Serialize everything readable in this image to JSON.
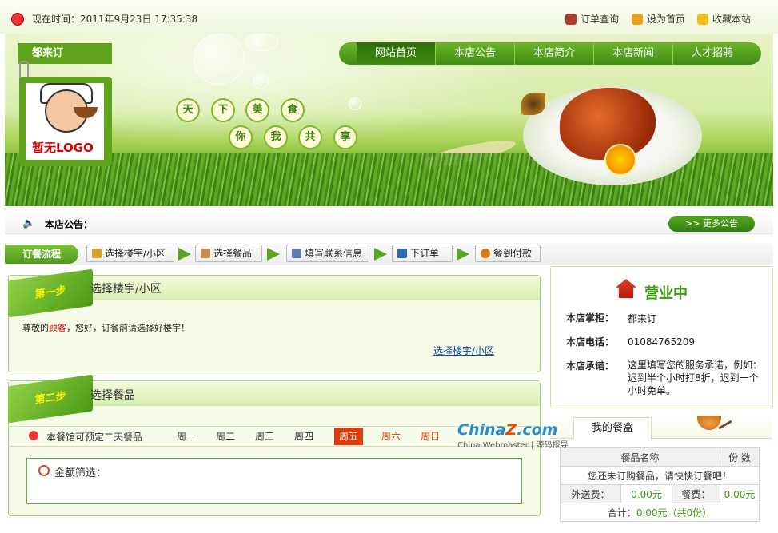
{
  "topbar": {
    "time_label": "现在时间：2011年9月23日 17:35:38",
    "links": [
      {
        "label": "订单查询",
        "icon": "cup-icon"
      },
      {
        "label": "设为首页",
        "icon": "home-icon"
      },
      {
        "label": "收藏本站",
        "icon": "folder-star-icon"
      }
    ]
  },
  "header": {
    "shop_name": "都来订",
    "logo_text": "暂无LOGO",
    "slogan_row1": [
      "天",
      "下",
      "美",
      "食"
    ],
    "slogan_row2": [
      "你",
      "我",
      "共",
      "享"
    ]
  },
  "nav": {
    "items": [
      "网站首页",
      "本店公告",
      "本店简介",
      "本店新闻",
      "人才招聘"
    ],
    "active": "网站首页"
  },
  "notice": {
    "label": "本店公告：",
    "more_label": ">> 更多公告"
  },
  "flow": {
    "label": "订餐流程",
    "steps": [
      {
        "label": "选择楼宇/小区",
        "icon": "building-icon"
      },
      {
        "label": "选择餐品",
        "icon": "bowl-icon"
      },
      {
        "label": "填写联系信息",
        "icon": "form-icon"
      },
      {
        "label": "下订单",
        "icon": "cart-icon"
      },
      {
        "label": "餐到付款",
        "icon": "money-icon"
      }
    ]
  },
  "step1": {
    "tag": "第一步",
    "title": "选择楼宇/小区",
    "text_before": "尊敬的",
    "text_highlight": "顾客",
    "text_after": "，您好，订餐前请选择好楼宇！",
    "link": "选择楼宇/小区"
  },
  "step2": {
    "tag": "第二步",
    "title": "选择餐品",
    "preorder_note": "本餐馆可预定二天餐品",
    "days": [
      "周一",
      "周二",
      "周三",
      "周四",
      "周五",
      "周六",
      "周日"
    ],
    "selected_day": "周五",
    "filter_label": "金额筛选："
  },
  "store": {
    "status": "营业中",
    "rows": [
      {
        "label": "本店掌柜：",
        "value": "都来订"
      },
      {
        "label": "本店电话：",
        "value": "01084765209"
      },
      {
        "label": "本店承诺：",
        "value": "这里填写您的服务承诺，例如：迟到半个小时打8折，迟到一个小时免单。"
      }
    ]
  },
  "mealbox": {
    "tab": "我的餐盒",
    "col_name": "餐品名称",
    "col_qty": "份 数",
    "empty_text": "您还未订购餐品，请快快订餐吧！",
    "delivery_label": "外送费：",
    "delivery_value": "0.00元",
    "meal_label": "餐费：",
    "meal_value": "0.00元",
    "total_label": "合计：",
    "total_value": "0.00元",
    "total_count": "（共0份）"
  },
  "watermark": {
    "brand_prefix": "China",
    "brand_z": "Z",
    "brand_suffix": ".com",
    "tagline": "China Webmaster | 源码报导"
  },
  "colors": {
    "accent_green": "#5fa31c",
    "selected_day": "#e03a0a",
    "highlight_red": "#c00000"
  }
}
